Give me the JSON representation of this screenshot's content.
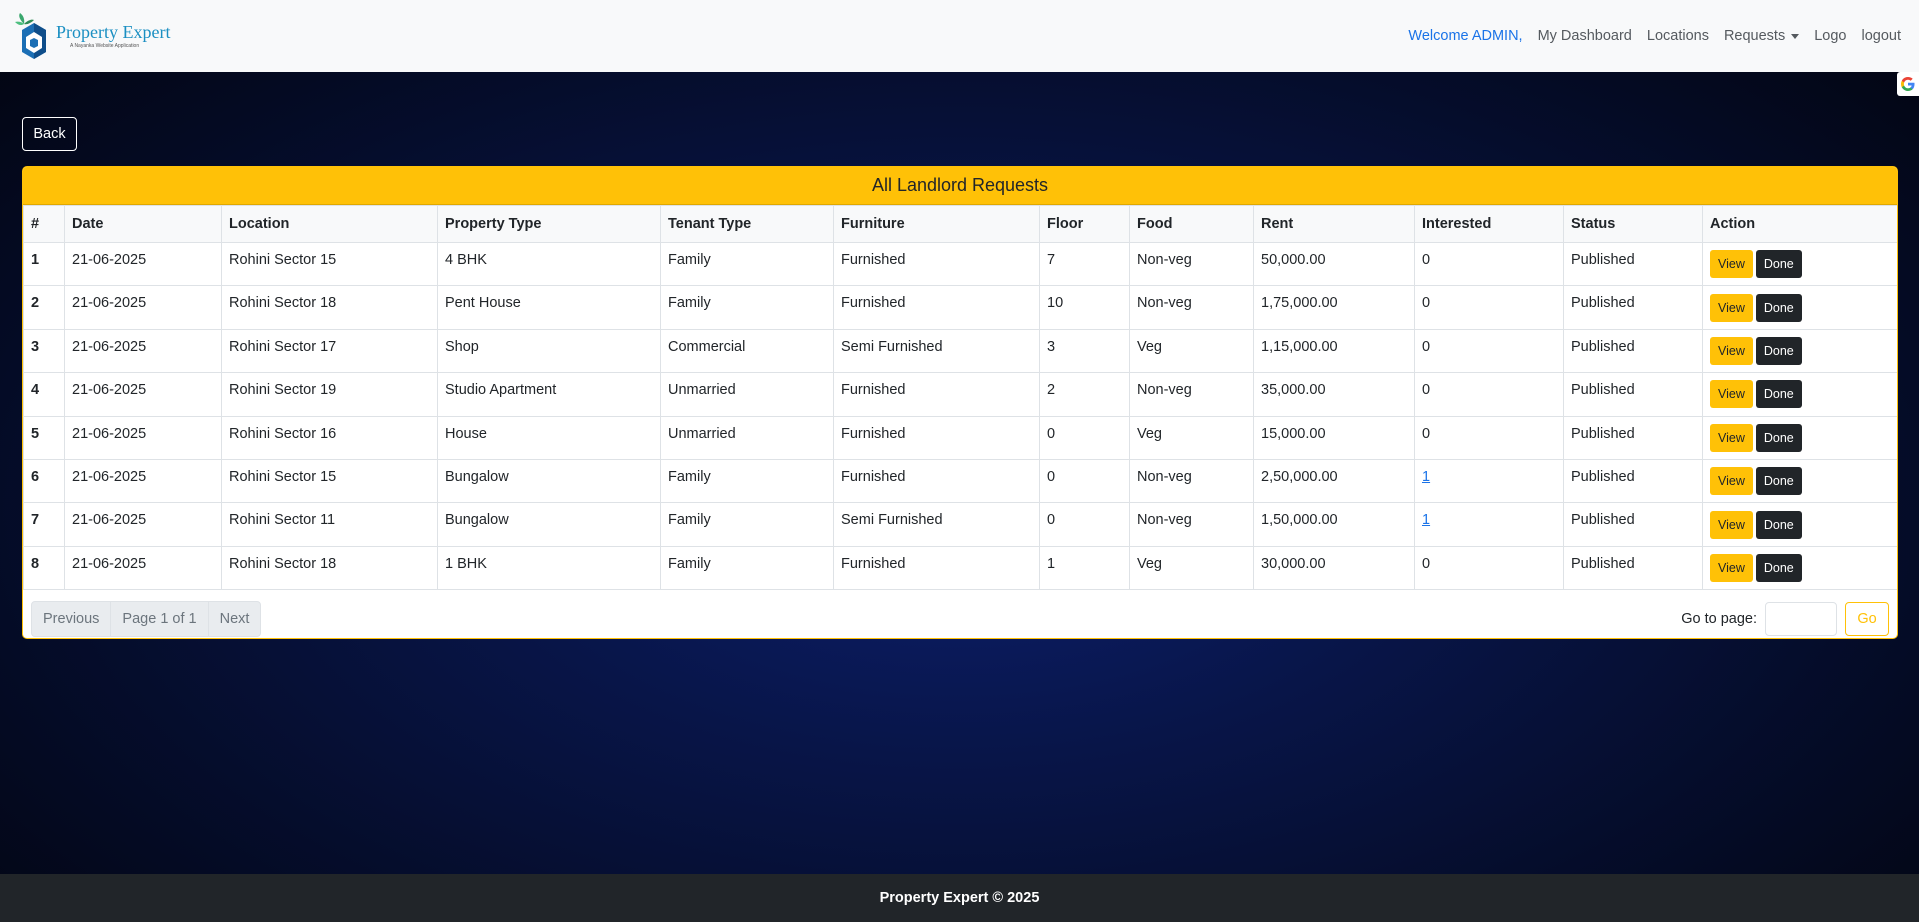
{
  "brand": {
    "name": "Property Expert",
    "tagline": "A Nayanka Website Application"
  },
  "nav": {
    "welcome": "Welcome ADMIN,",
    "dashboard": "My Dashboard",
    "locations": "Locations",
    "requests": "Requests",
    "logo": "Logo",
    "logout": "logout"
  },
  "back_label": "Back",
  "card": {
    "title": "All Landlord Requests",
    "columns": [
      "#",
      "Date",
      "Location",
      "Property Type",
      "Tenant Type",
      "Furniture",
      "Floor",
      "Food",
      "Rent",
      "Interested",
      "Status",
      "Action"
    ],
    "rows": [
      {
        "n": "1",
        "date": "21-06-2025",
        "location": "Rohini Sector 15",
        "ptype": "4 BHK",
        "tenant": "Family",
        "furniture": "Furnished",
        "floor": "7",
        "food": "Non-veg",
        "rent": "50,000.00",
        "interested": "0",
        "interested_link": false,
        "status": "Published"
      },
      {
        "n": "2",
        "date": "21-06-2025",
        "location": "Rohini Sector 18",
        "ptype": "Pent House",
        "tenant": "Family",
        "furniture": "Furnished",
        "floor": "10",
        "food": "Non-veg",
        "rent": "1,75,000.00",
        "interested": "0",
        "interested_link": false,
        "status": "Published"
      },
      {
        "n": "3",
        "date": "21-06-2025",
        "location": "Rohini Sector 17",
        "ptype": "Shop",
        "tenant": "Commercial",
        "furniture": "Semi Furnished",
        "floor": "3",
        "food": "Veg",
        "rent": "1,15,000.00",
        "interested": "0",
        "interested_link": false,
        "status": "Published"
      },
      {
        "n": "4",
        "date": "21-06-2025",
        "location": "Rohini Sector 19",
        "ptype": "Studio Apartment",
        "tenant": "Unmarried",
        "furniture": "Furnished",
        "floor": "2",
        "food": "Non-veg",
        "rent": "35,000.00",
        "interested": "0",
        "interested_link": false,
        "status": "Published"
      },
      {
        "n": "5",
        "date": "21-06-2025",
        "location": "Rohini Sector 16",
        "ptype": "House",
        "tenant": "Unmarried",
        "furniture": "Furnished",
        "floor": "0",
        "food": "Veg",
        "rent": "15,000.00",
        "interested": "0",
        "interested_link": false,
        "status": "Published"
      },
      {
        "n": "6",
        "date": "21-06-2025",
        "location": "Rohini Sector 15",
        "ptype": "Bungalow",
        "tenant": "Family",
        "furniture": "Furnished",
        "floor": "0",
        "food": "Non-veg",
        "rent": "2,50,000.00",
        "interested": "1",
        "interested_link": true,
        "status": "Published"
      },
      {
        "n": "7",
        "date": "21-06-2025",
        "location": "Rohini Sector 11",
        "ptype": "Bungalow",
        "tenant": "Family",
        "furniture": "Semi Furnished",
        "floor": "0",
        "food": "Non-veg",
        "rent": "1,50,000.00",
        "interested": "1",
        "interested_link": true,
        "status": "Published"
      },
      {
        "n": "8",
        "date": "21-06-2025",
        "location": "Rohini Sector 18",
        "ptype": "1 BHK",
        "tenant": "Family",
        "furniture": "Furnished",
        "floor": "1",
        "food": "Veg",
        "rent": "30,000.00",
        "interested": "0",
        "interested_link": false,
        "status": "Published"
      }
    ],
    "actions": {
      "view": "View",
      "done": "Done"
    },
    "pagination": {
      "previous": "Previous",
      "page_info": "Page 1 of 1",
      "next": "Next"
    },
    "goto": {
      "label": "Go to page:",
      "value": "",
      "button": "Go"
    }
  },
  "footer": "Property Expert © 2025",
  "colors": {
    "accent": "#ffc107",
    "dark": "#212529",
    "link": "#1a73e8"
  },
  "icons": {
    "translate_badge": "google-g-icon",
    "dropdown": "caret-down-icon"
  }
}
